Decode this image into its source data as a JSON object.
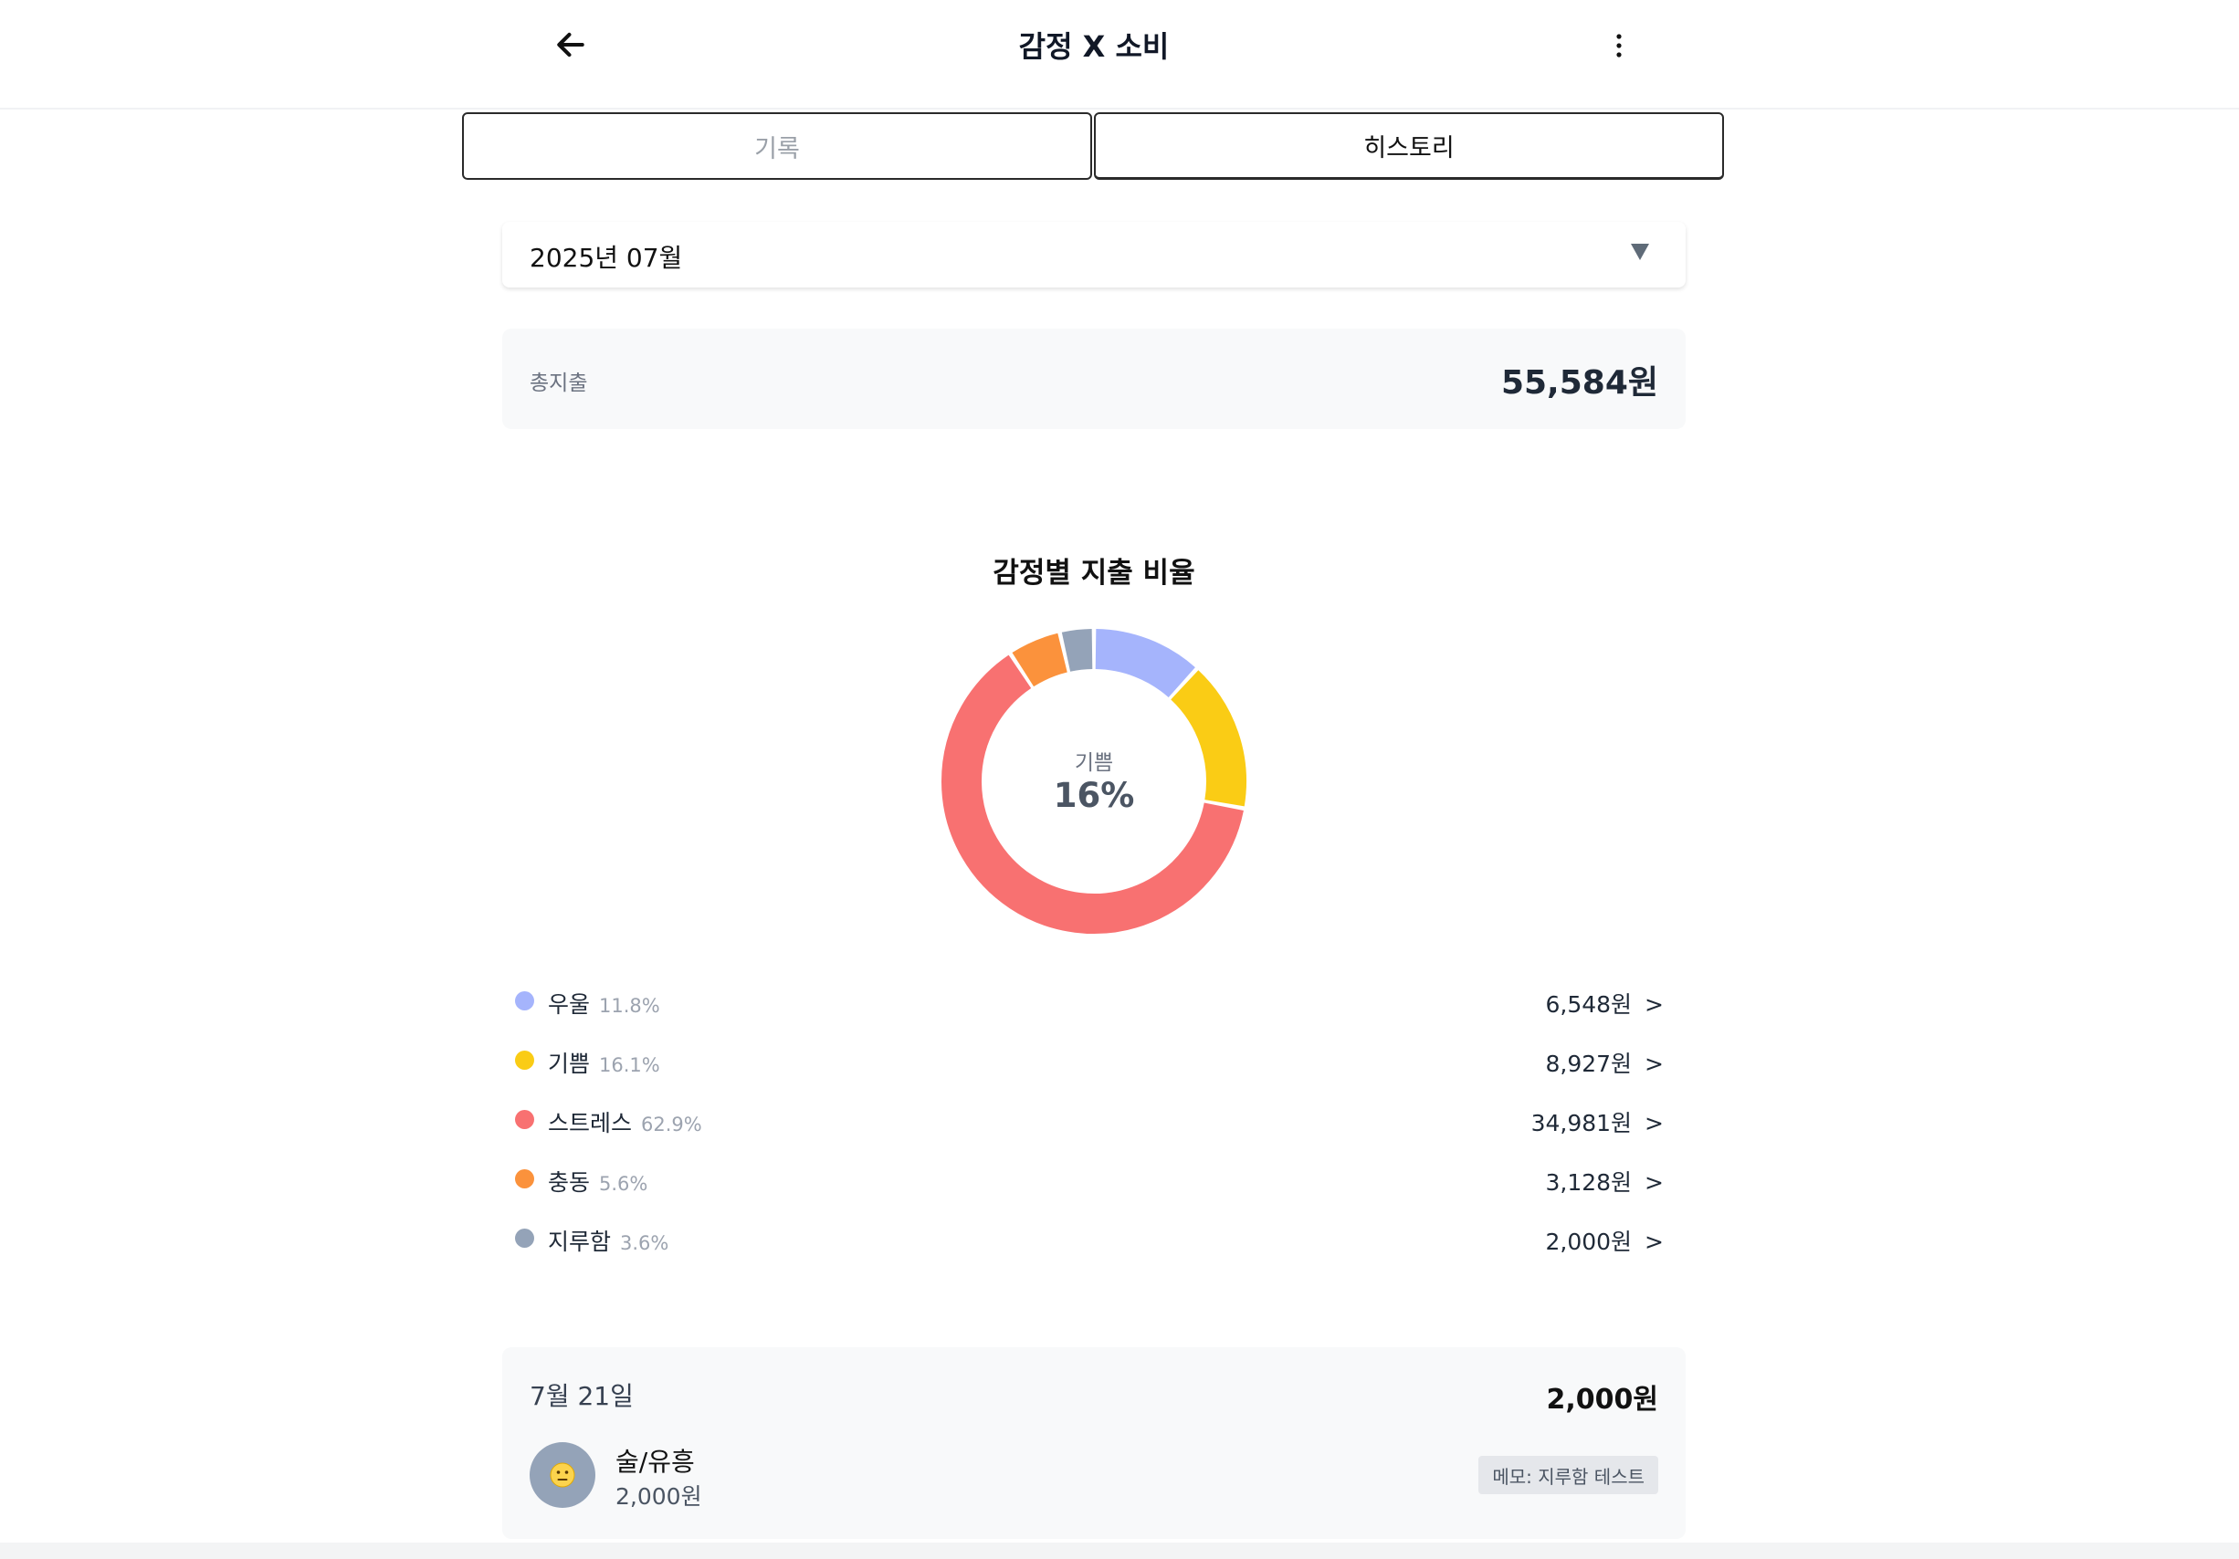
{
  "header": {
    "title": "감정 X 소비",
    "back_icon": "arrow-left-icon",
    "more_icon": "more-vertical-icon"
  },
  "tabs": [
    {
      "label": "기록",
      "active": false
    },
    {
      "label": "히스토리",
      "active": true
    }
  ],
  "month_select": {
    "value": "2025년 07월",
    "icon": "caret-down-icon"
  },
  "total": {
    "label": "총지출",
    "value": "55,584원"
  },
  "chart_data": {
    "type": "pie",
    "title": "감정별 지출 비율",
    "center": {
      "label": "기쁨",
      "value": "16%"
    },
    "categories": [
      "우울",
      "기쁨",
      "스트레스",
      "충동",
      "지루함"
    ],
    "values": [
      6548,
      8927,
      34981,
      3128,
      2000
    ],
    "percent_labels": [
      "11.8%",
      "16.1%",
      "62.9%",
      "5.6%",
      "3.6%"
    ],
    "amount_labels": [
      "6,548원",
      "8,927원",
      "34,981원",
      "3,128원",
      "2,000원"
    ],
    "colors": [
      "#a5b4fc",
      "#facc15",
      "#f87171",
      "#fb923c",
      "#94a3b8"
    ],
    "highlighted": "기쁨"
  },
  "legend_arrow": ">",
  "entries": [
    {
      "date": "7월 21일",
      "total": "2,000원",
      "items": [
        {
          "emoji": "😐",
          "category": "술/유흥",
          "amount": "2,000원",
          "memo": "메모: 지루함 테스트"
        }
      ]
    }
  ]
}
